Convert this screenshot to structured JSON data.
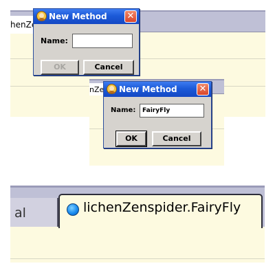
{
  "snapshot1": {
    "background_tab": "henZe",
    "dialog": {
      "title": "New Method",
      "name_label": "Name:",
      "name_value": "",
      "ok_label": "OK",
      "cancel_label": "Cancel",
      "ok_enabled": false
    }
  },
  "snapshot2": {
    "background_tab": "nZe",
    "dialog": {
      "title": "New Method",
      "name_label": "Name:",
      "name_value": "FairyFly",
      "ok_label": "OK",
      "cancel_label": "Cancel",
      "ok_enabled": true
    }
  },
  "snapshot3": {
    "previous_tab_label": "al",
    "active_tab_label": "lichenZenspider.FairyFly"
  },
  "icons": {
    "title_icon": "greenfoot-person-icon",
    "close_icon": "close-icon",
    "tab_icon": "blue-circle-icon"
  },
  "colors": {
    "titlebar": "#1c5ad8",
    "editor_background": "#fdfae0",
    "tabbar_background": "#bfc0d6",
    "close_button": "#d9452a"
  }
}
